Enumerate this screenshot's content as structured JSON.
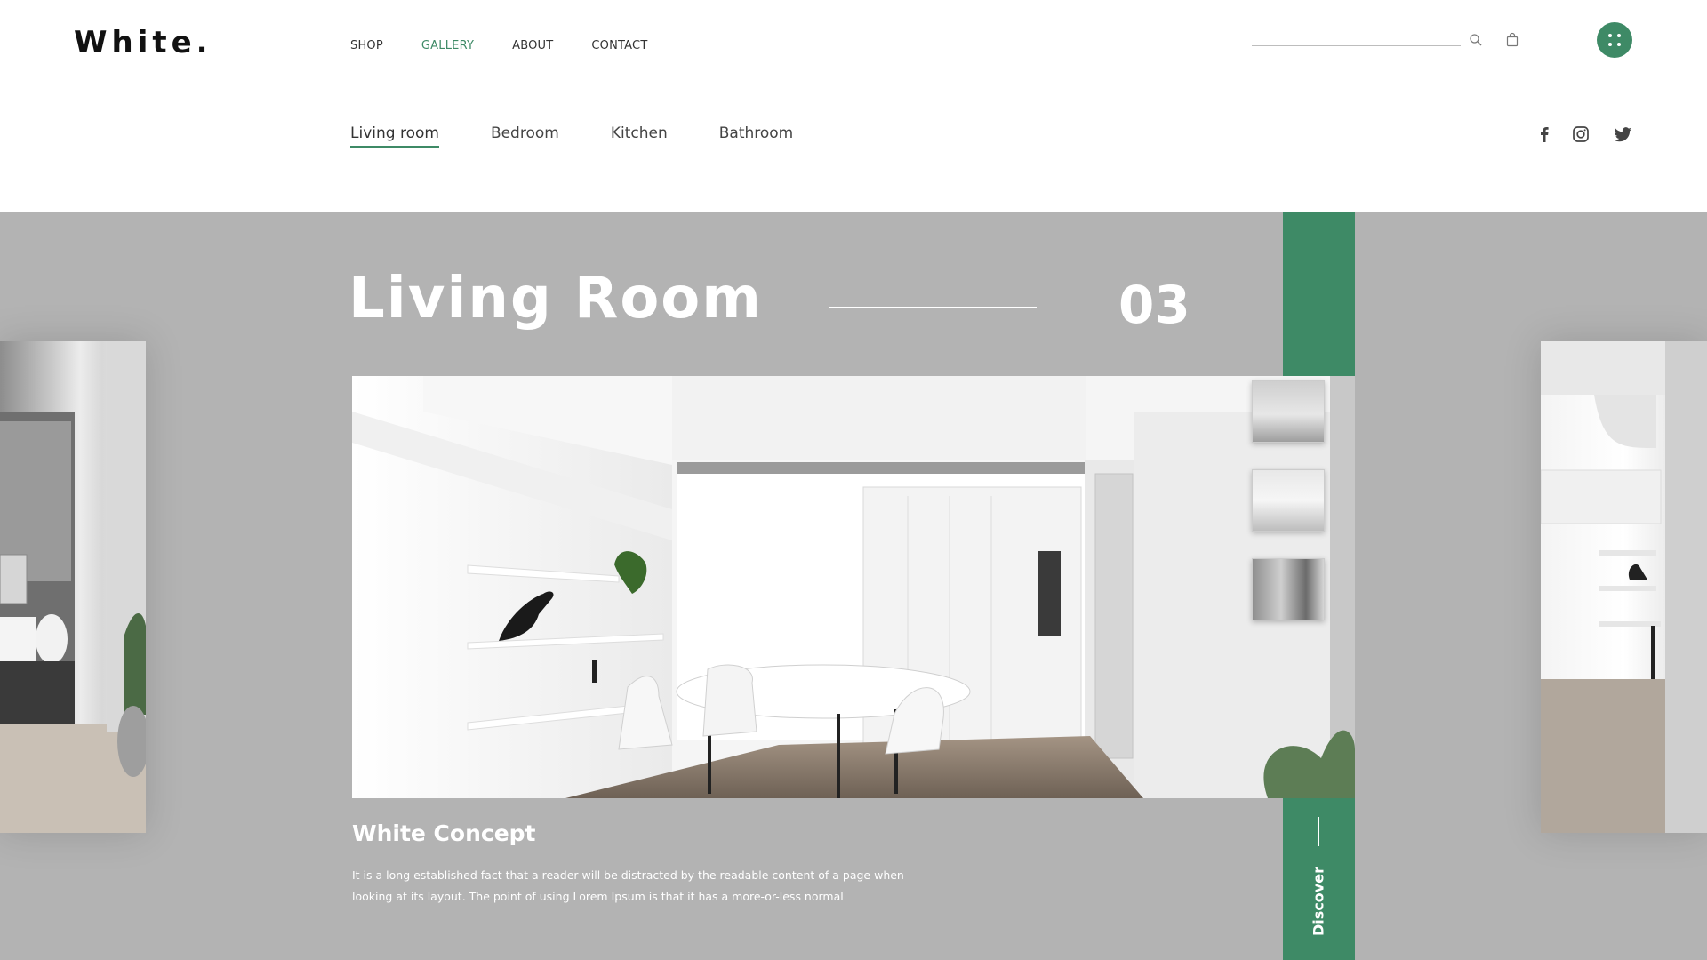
{
  "brand": {
    "logo": "White."
  },
  "nav": {
    "items": [
      {
        "label": "SHOP",
        "active": false
      },
      {
        "label": "GALLERY",
        "active": true
      },
      {
        "label": "ABOUT",
        "active": false
      },
      {
        "label": "CONTACT",
        "active": false
      }
    ]
  },
  "header": {
    "search_value": "",
    "search_placeholder": "",
    "icons": [
      "search-icon",
      "bag-icon",
      "menu-dots-icon"
    ]
  },
  "categories": [
    {
      "label": "Living room",
      "active": true
    },
    {
      "label": "Bedroom",
      "active": false
    },
    {
      "label": "Kitchen",
      "active": false
    },
    {
      "label": "Bathroom",
      "active": false
    }
  ],
  "social": [
    "facebook-icon",
    "instagram-icon",
    "twitter-icon"
  ],
  "hero": {
    "title": "Living Room",
    "slide_number": "03",
    "concept_title": "White Concept",
    "concept_description": "It is a long established fact that a reader will be distracted by the readable content of a page when looking at its layout. The point of using Lorem Ipsum is that it has a more-or-less normal",
    "discover_label": "Discover"
  },
  "colors": {
    "accent": "#3e8a66",
    "stage_bg": "#b3b3b3",
    "text_dark": "#111111"
  }
}
